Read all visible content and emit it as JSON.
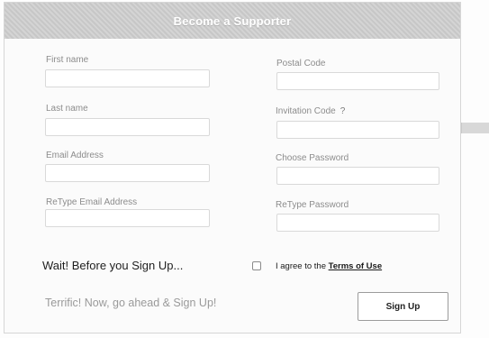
{
  "header": {
    "title": "Become a Supporter"
  },
  "form": {
    "first_name_label": "First name",
    "last_name_label": "Last name",
    "email_label": "Email Address",
    "retype_email_label": "ReType Email Address",
    "postal_code_label": "Postal Code",
    "invitation_code_label": "Invitation Code",
    "invitation_help": "?",
    "password_label": "Choose Password",
    "retype_password_label": "ReType Password"
  },
  "footer": {
    "wait_text": "Wait! Before you Sign Up...",
    "agree_prefix": "I agree to the ",
    "terms_link": "Terms of Use",
    "terrific_text": "Terrific! Now, go ahead & Sign Up!",
    "signup_label": "Sign Up"
  },
  "colors": {
    "header_bg": "#cfcfcf",
    "header_text": "#ffffff",
    "label_text": "#8c8c8c"
  },
  "icons": {
    "help": "question-mark-icon"
  }
}
